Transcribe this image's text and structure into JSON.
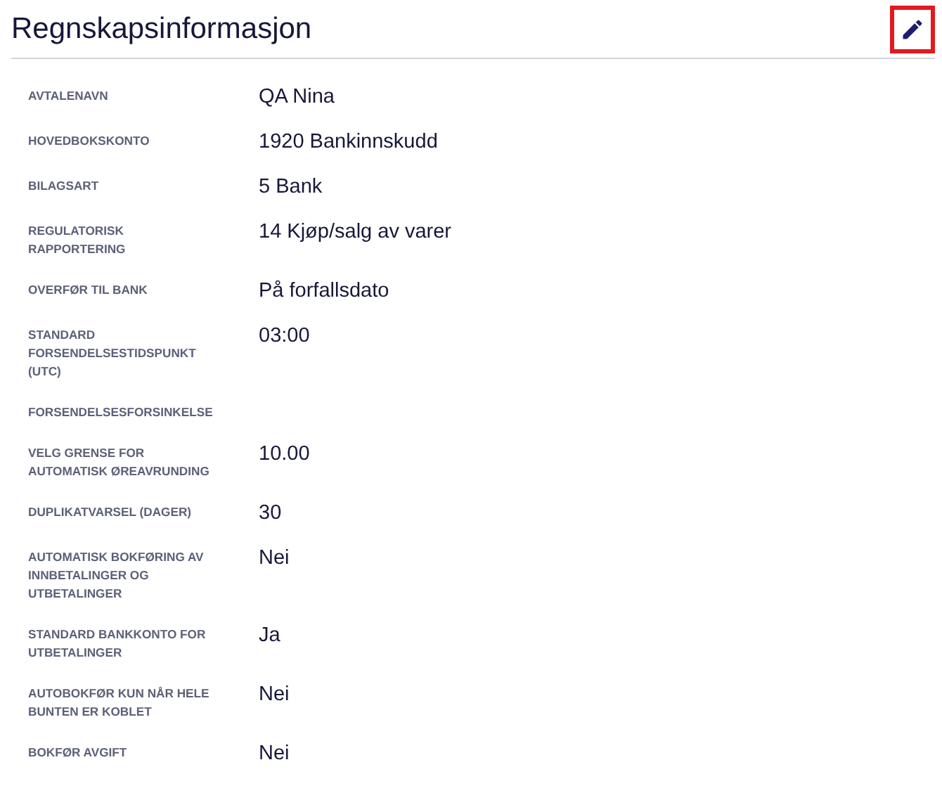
{
  "header": {
    "title": "Regnskapsinformasjon",
    "edit_button": {
      "highlighted": true
    }
  },
  "fields": [
    {
      "label": "AVTALENAVN",
      "value": "QA Nina"
    },
    {
      "label": "HOVEDBOKSKONTO",
      "value": "1920 Bankinnskudd"
    },
    {
      "label": "BILAGSART",
      "value": "5 Bank"
    },
    {
      "label": "REGULATORISK RAPPORTERING",
      "value": "14 Kjøp/salg av varer"
    },
    {
      "label": "OVERFØR TIL BANK",
      "value": "På forfallsdato"
    },
    {
      "label": "STANDARD FORSENDELSESTIDSPUNKT (UTC)",
      "value": "03:00"
    },
    {
      "label": "FORSENDELSESFORSINKELSE"
    },
    {
      "label": "VELG GRENSE FOR AUTOMATISK ØREAVRUNDING",
      "value": "10.00"
    },
    {
      "label": "DUPLIKATVARSEL (DAGER)",
      "value": "30"
    },
    {
      "label": "AUTOMATISK BOKFØRING AV INNBETALINGER OG UTBETALINGER",
      "value": "Nei"
    },
    {
      "label": "STANDARD BANKKONTO FOR UTBETALINGER",
      "value": "Ja"
    },
    {
      "label": "AUTOBOKFØR KUN NÅR HELE BUNTEN ER KOBLET",
      "value": "Nei"
    },
    {
      "label": "BOKFØR AVGIFT",
      "value": "Nei"
    }
  ]
}
